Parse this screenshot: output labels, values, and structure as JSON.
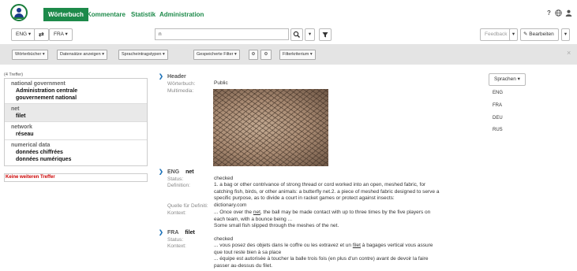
{
  "nav": {
    "active": "Wörterbuch",
    "links": [
      "Kommentare",
      "Statistik",
      "Administration"
    ],
    "help": "?",
    "globe": "globe-icon",
    "user": "user-icon"
  },
  "toolbar": {
    "source_lang": "ENG ▾",
    "swap": "⇄",
    "target_lang": "FRA ▾",
    "search_value": "n",
    "feedback": "Feedback",
    "edit": "Bearbeiten"
  },
  "filters": {
    "dictionaries": "Wörterbücher ▾",
    "show_records": "Datensätze anzeigen ▾",
    "entry_types": "Spracheintragstypen ▾",
    "saved_filters": "Gespeicherte Filter ▾",
    "criterion": "Filterkriterium ▾",
    "close": "×"
  },
  "results": {
    "count": "(4 Treffer)",
    "groups": [
      {
        "src": "national government",
        "tgt": [
          "Administration centrale",
          "gouvernement national"
        ]
      },
      {
        "src": "net",
        "tgt": [
          "filet"
        ]
      },
      {
        "src": "network",
        "tgt": [
          "réseau"
        ]
      },
      {
        "src": "numerical data",
        "tgt": [
          "données chiffrées",
          "données numériques"
        ]
      }
    ],
    "no_more": "Keine weiteren Treffer"
  },
  "detail": {
    "header": {
      "title": "Header",
      "dict_label": "Wörterbuch:",
      "dict_value": "Public",
      "media_label": "Multimedia:"
    },
    "eng": {
      "lang": "ENG",
      "term": "net",
      "status_label": "Status:",
      "status": "checked",
      "def_label": "Definition:",
      "def": [
        "1. a bag or other contrivance of strong thread or cord worked into an open, meshed fabric, for",
        "catching fish, birds, or other animals: a butterfly net.2. a piece of meshed fabric designed to serve a",
        "specific purpose, as to divide a court in racket games or protect against insects:"
      ],
      "source_label": "Quelle für Definiti:",
      "source": "dictionary.com",
      "ctx_label": "Kontext:",
      "ctx1_a": "... Once over the ",
      "ctx1_b": "net",
      "ctx1_c": ", the ball may be made contact with up to three times by the five players on",
      "ctx1_line2": "each team, with a bounce being ...",
      "ctx2": "Some small fish slipped through the meshes of the net."
    },
    "fra": {
      "lang": "FRA",
      "term": "filet",
      "status_label": "Status:",
      "status": "checked",
      "ctx_label": "Kontext:",
      "ctx1_a": "... vous posez des objets dans le coffre ou les extravez et un ",
      "ctx1_b": "filet",
      "ctx1_c": " à bagages vertical vous assure",
      "ctx1_line2": "que tout reste bien à sa place",
      "ctx2_line1": "... équipe est autorisée à toucher la balle trois fois (en plus d'un contre) avant de devoir la faire",
      "ctx2_line2": "passer au-dessus du filet."
    }
  },
  "languages": {
    "button": "Sprachen ▾",
    "items": [
      "ENG",
      "FRA",
      "DEU",
      "RUS"
    ]
  },
  "colors": {
    "accent": "#1d8a4a",
    "link": "#1d72b8",
    "error": "#cc0000"
  }
}
